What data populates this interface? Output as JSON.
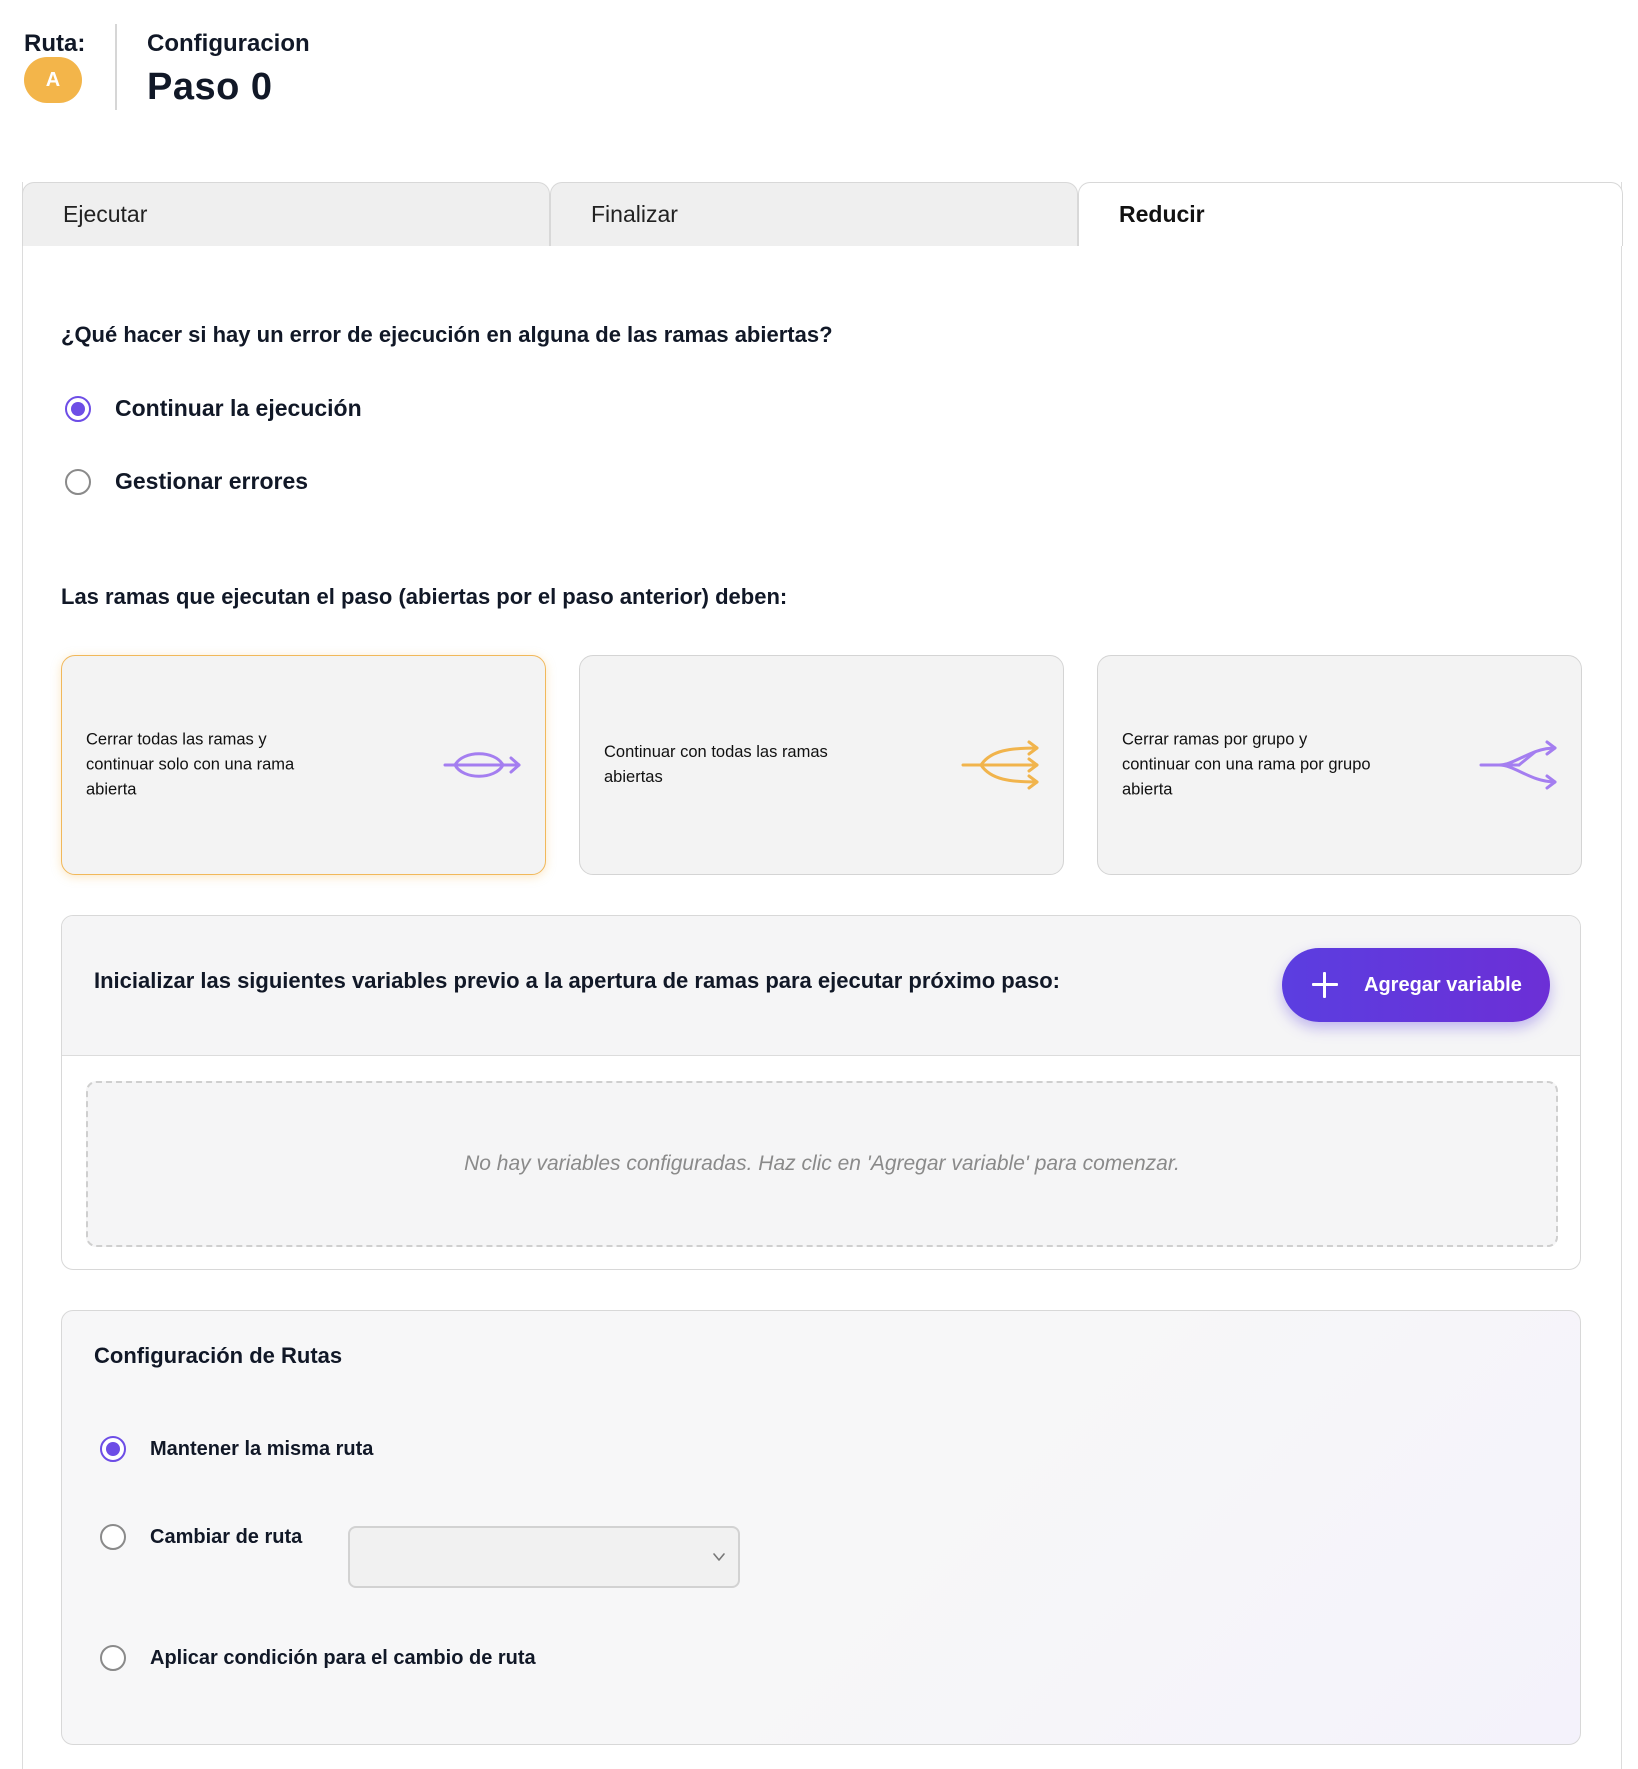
{
  "header": {
    "ruta_label": "Ruta:",
    "ruta_badge": "A",
    "config_label": "Configuracion",
    "step_title": "Paso 0"
  },
  "tabs": [
    {
      "label": "Ejecutar",
      "active": false
    },
    {
      "label": "Finalizar",
      "active": false
    },
    {
      "label": "Reducir",
      "active": true
    }
  ],
  "error_section": {
    "question": "¿Qué hacer si hay un error de ejecución en alguna de las ramas abiertas?",
    "options": [
      {
        "label": "Continuar la ejecución",
        "checked": true
      },
      {
        "label": "Gestionar errores",
        "checked": false
      }
    ]
  },
  "branches_section": {
    "title": "Las ramas que ejecutan el paso (abiertas por el paso anterior) deben:",
    "cards": [
      {
        "text": "Cerrar todas las ramas y continuar solo con una rama abierta",
        "icon": "merge-branches-icon",
        "icon_color": "#a47ef0",
        "selected": true
      },
      {
        "text": "Continuar con todas las ramas abiertas",
        "icon": "split-branches-icon",
        "icon_color": "#f1b44c",
        "selected": false
      },
      {
        "text": "Cerrar ramas por grupo y continuar con una rama por grupo abierta",
        "icon": "group-branches-icon",
        "icon_color": "#a47ef0",
        "selected": false
      }
    ]
  },
  "variables": {
    "title": "Inicializar las siguientes variables previo a la apertura de ramas para ejecutar próximo paso:",
    "add_button": "Agregar variable",
    "empty_message": "No hay variables configuradas. Haz clic en 'Agregar variable' para comenzar."
  },
  "routes": {
    "title": "Configuración de Rutas",
    "options": [
      {
        "label": "Mantener la misma ruta",
        "checked": true
      },
      {
        "label": "Cambiar de ruta",
        "checked": false
      },
      {
        "label": "Aplicar condición para el cambio de ruta",
        "checked": false
      }
    ],
    "select_value": ""
  },
  "colors": {
    "accent": "#6d4de6",
    "badge": "#f3b54a",
    "selected_border": "#f1b85a"
  }
}
